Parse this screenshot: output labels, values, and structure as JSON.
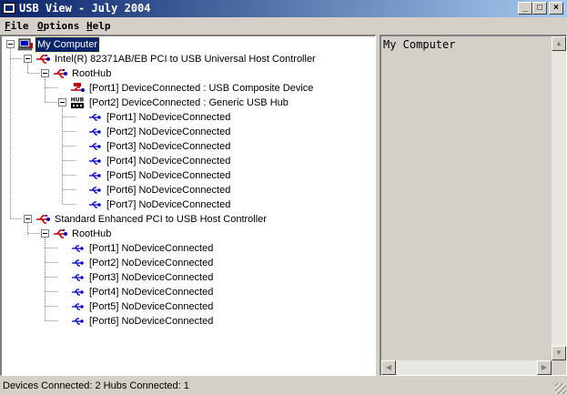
{
  "window": {
    "title": "USB View - July 2004"
  },
  "menu": [
    {
      "accel": "F",
      "rest": "ile"
    },
    {
      "accel": "O",
      "rest": "ptions"
    },
    {
      "accel": "H",
      "rest": "elp"
    }
  ],
  "tree": {
    "root": "My Computer",
    "controller1": {
      "label": "Intel(R) 82371AB/EB PCI to USB Universal Host Controller",
      "roothub": "RootHub",
      "port1": "[Port1] DeviceConnected :  USB Composite Device",
      "port2": "[Port2] DeviceConnected :  Generic USB Hub",
      "hub_ports": [
        "[Port1] NoDeviceConnected",
        "[Port2] NoDeviceConnected",
        "[Port3] NoDeviceConnected",
        "[Port4] NoDeviceConnected",
        "[Port5] NoDeviceConnected",
        "[Port6] NoDeviceConnected",
        "[Port7] NoDeviceConnected"
      ]
    },
    "controller2": {
      "label": "Standard Enhanced PCI to USB Host Controller",
      "roothub": "RootHub",
      "ports": [
        "[Port1] NoDeviceConnected",
        "[Port2] NoDeviceConnected",
        "[Port3] NoDeviceConnected",
        "[Port4] NoDeviceConnected",
        "[Port5] NoDeviceConnected",
        "[Port6] NoDeviceConnected"
      ]
    }
  },
  "detail": {
    "text": "My Computer"
  },
  "status": {
    "text": "Devices Connected: 2   Hubs Connected: 1"
  },
  "icons": {
    "computer": "computer-icon",
    "usb": "usb-plug-icon",
    "hub": "hub-icon",
    "port": "usb-port-icon"
  },
  "colors": {
    "title_start": "#0a246a",
    "title_end": "#a6caf0",
    "selection": "#0a246a",
    "usb_red": "#c00000",
    "usb_blue": "#0000c0"
  }
}
